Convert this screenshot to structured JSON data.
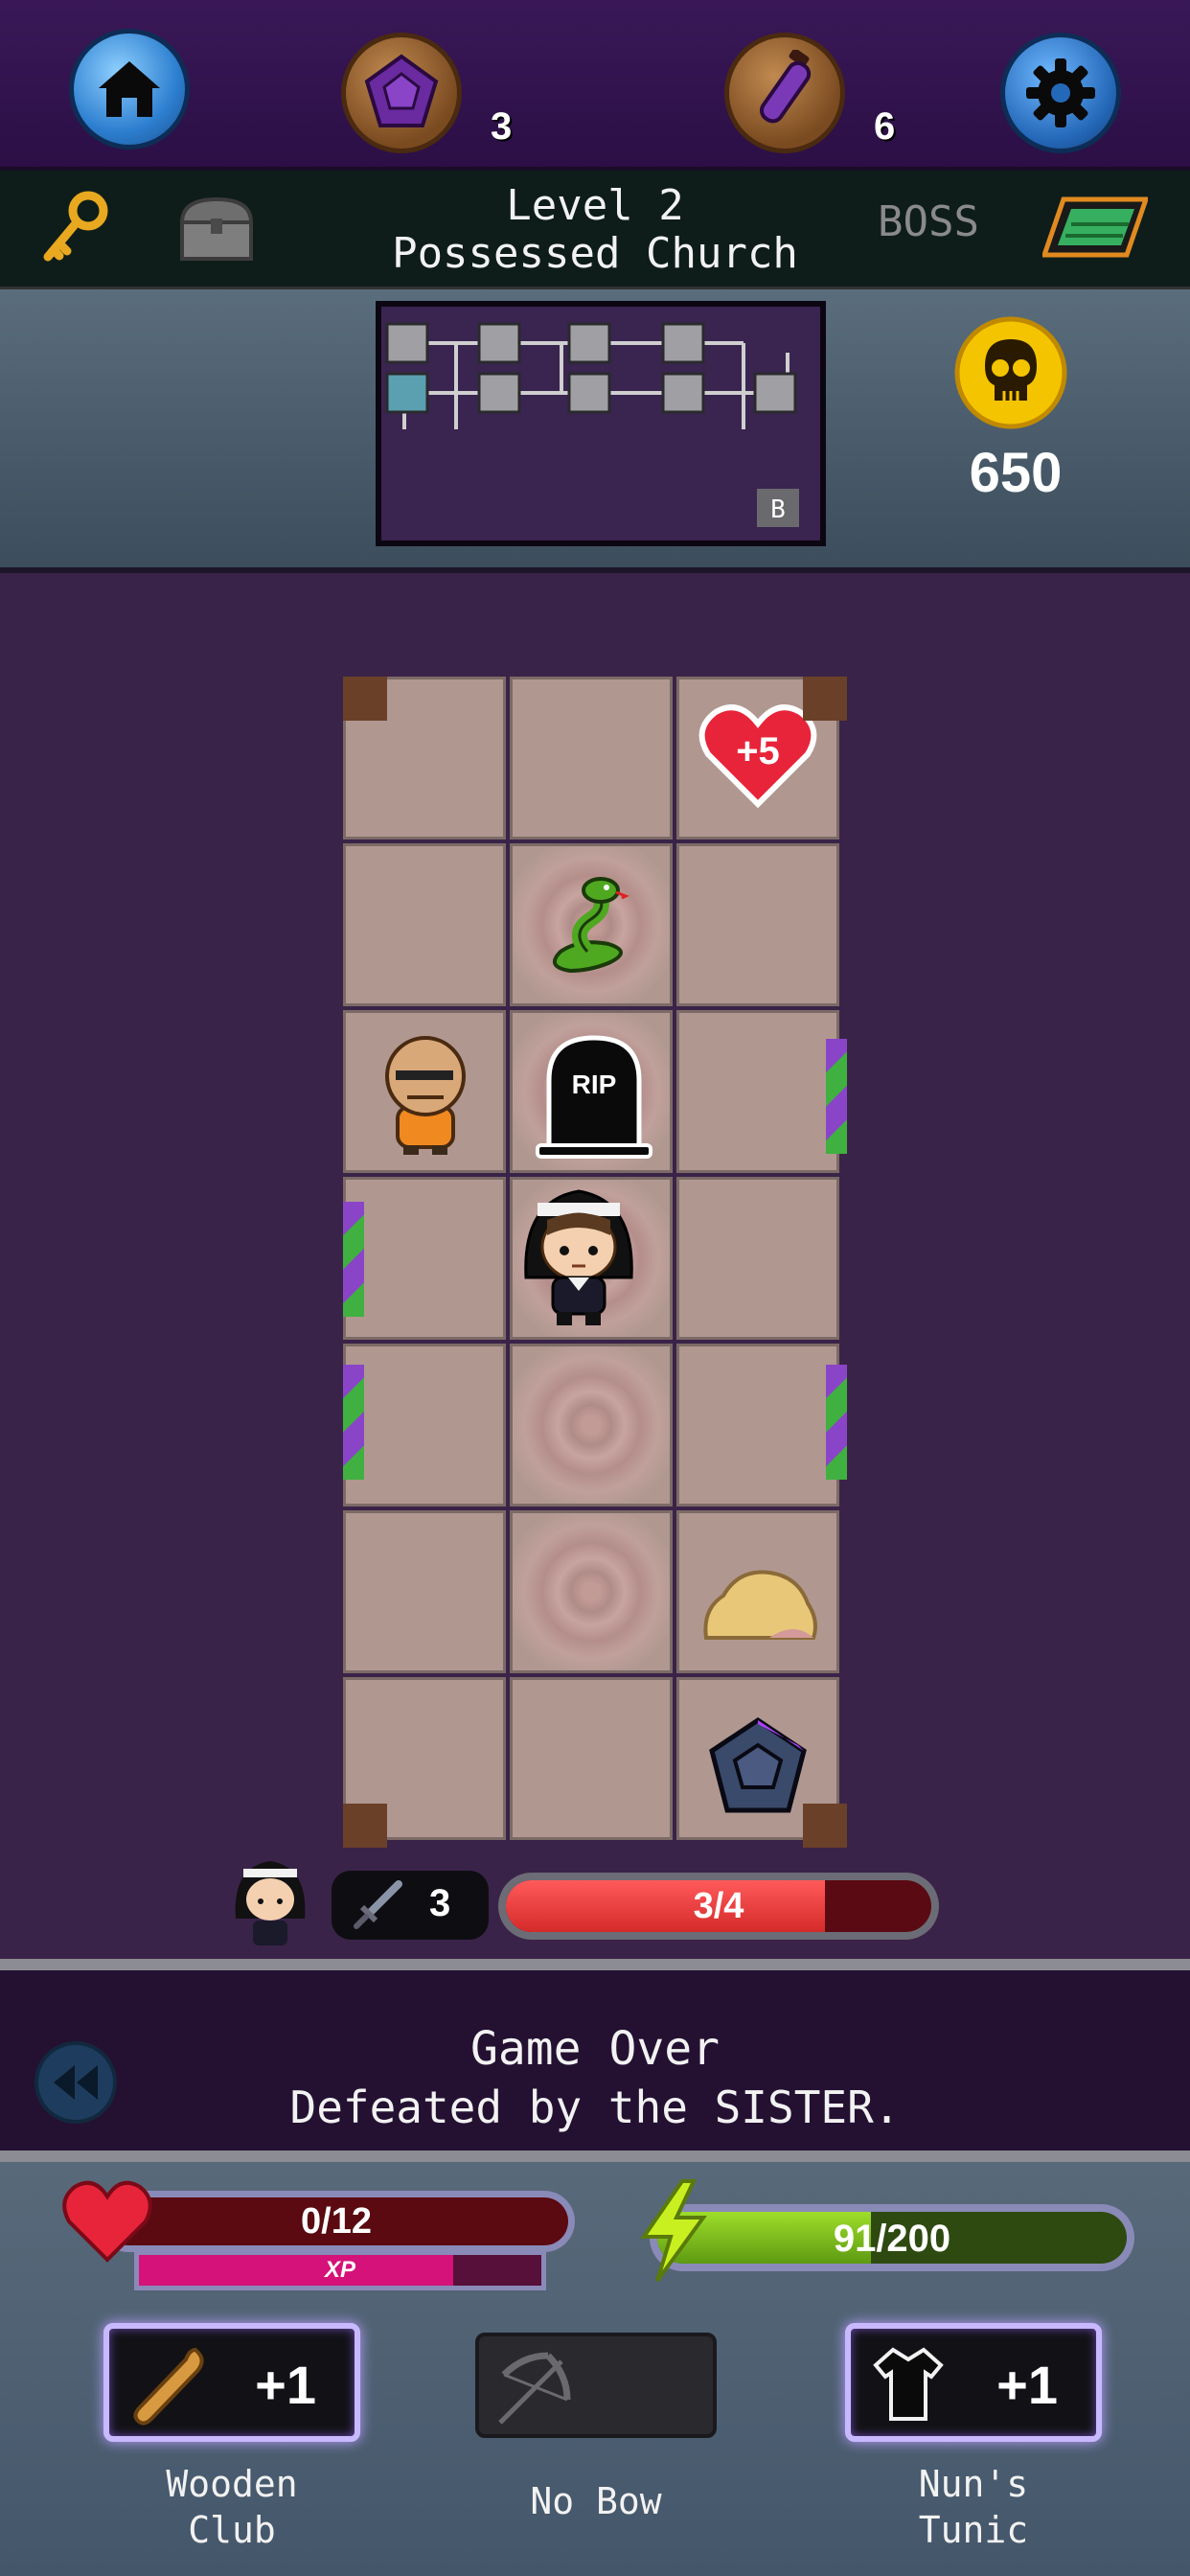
{
  "top_bar": {
    "gem_count": "3",
    "potion_count": "6"
  },
  "level_bar": {
    "level": "Level 2",
    "location": "Possessed Church",
    "boss_label": "BOSS"
  },
  "minimap": {
    "boss_marker": "B"
  },
  "gold": {
    "amount": "650"
  },
  "board": {
    "heart_pickup": "+5",
    "tombstone_text": "RIP"
  },
  "enemy_status": {
    "attack": "3",
    "hp_text": "3/4",
    "hp_fraction": 0.75
  },
  "message": {
    "title": "Game Over",
    "subtitle": "Defeated by the SISTER."
  },
  "player": {
    "hp_text": "0/12",
    "hp_fraction": 0,
    "xp_label": "XP",
    "xp_fraction": 0.78,
    "energy_text": "91/200",
    "energy_fraction": 0.455
  },
  "equipment": [
    {
      "name_line1": "Wooden",
      "name_line2": "Club",
      "bonus": "+1"
    },
    {
      "name_line1": "No Bow",
      "name_line2": "",
      "bonus": ""
    },
    {
      "name_line1": "Nun's",
      "name_line2": "Tunic",
      "bonus": "+1"
    }
  ],
  "colors": {
    "hp_red": "#d22222",
    "energy_green": "#9ede2a",
    "xp_pink": "#d4127a",
    "gold_yellow": "#f5c400"
  }
}
